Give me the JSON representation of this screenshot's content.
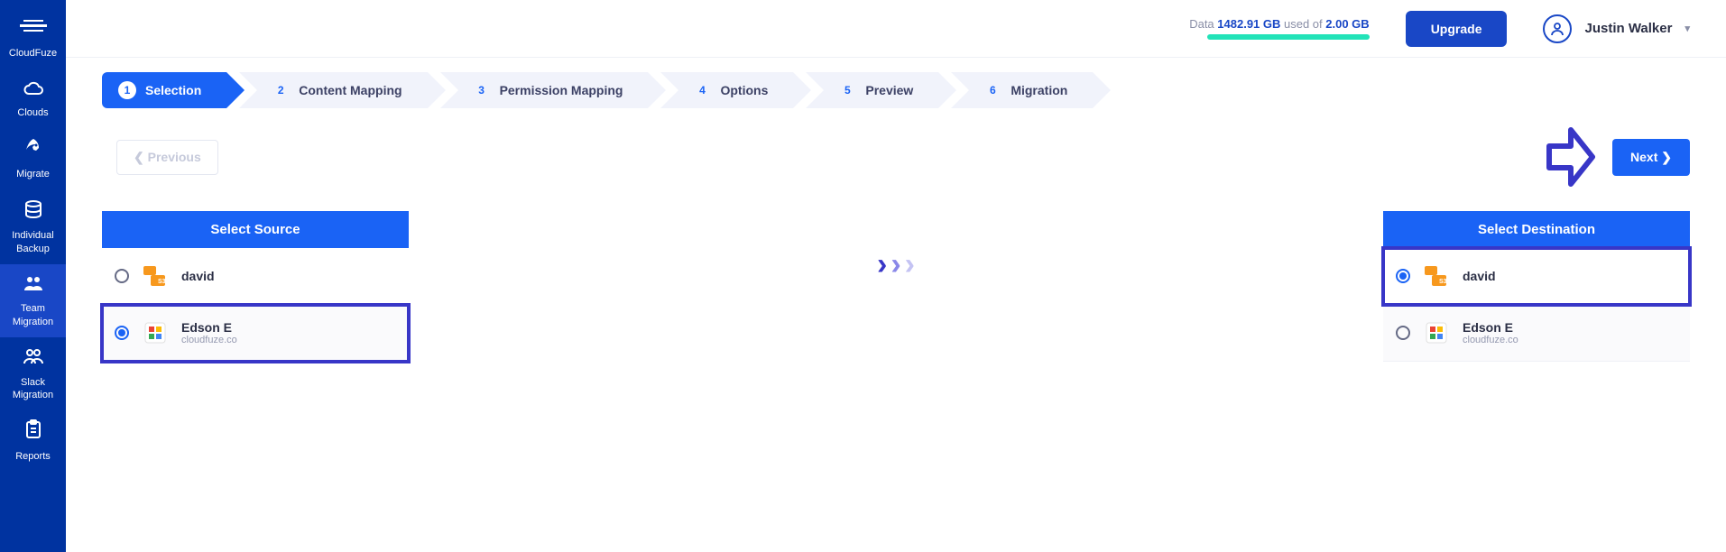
{
  "sidebar": {
    "brand": "CloudFuze",
    "items": [
      {
        "label": "CloudFuze",
        "icon": "logo"
      },
      {
        "label": "Clouds",
        "icon": "cloud"
      },
      {
        "label": "Migrate",
        "icon": "rocket"
      },
      {
        "label": "Individual Backup",
        "icon": "db"
      },
      {
        "label": "Team Migration",
        "icon": "team"
      },
      {
        "label": "Slack Migration",
        "icon": "slack"
      },
      {
        "label": "Reports",
        "icon": "report"
      }
    ]
  },
  "topbar": {
    "data_prefix": "Data ",
    "data_used": "1482.91 GB",
    "data_mid": " used of ",
    "data_total": "2.00 GB",
    "upgrade": "Upgrade",
    "user_name": "Justin Walker"
  },
  "stepper": [
    {
      "num": "1",
      "label": "Selection"
    },
    {
      "num": "2",
      "label": "Content Mapping"
    },
    {
      "num": "3",
      "label": "Permission Mapping"
    },
    {
      "num": "4",
      "label": "Options"
    },
    {
      "num": "5",
      "label": "Preview"
    },
    {
      "num": "6",
      "label": "Migration"
    }
  ],
  "nav": {
    "previous": "Previous",
    "next": "Next"
  },
  "source": {
    "title": "Select Source",
    "items": [
      {
        "name": "david",
        "sub": "",
        "cloud": "aws"
      },
      {
        "name": "Edson E",
        "sub": "cloudfuze.co",
        "cloud": "google"
      }
    ]
  },
  "destination": {
    "title": "Select Destination",
    "items": [
      {
        "name": "david",
        "sub": "",
        "cloud": "aws"
      },
      {
        "name": "Edson E",
        "sub": "cloudfuze.co",
        "cloud": "google"
      }
    ]
  }
}
